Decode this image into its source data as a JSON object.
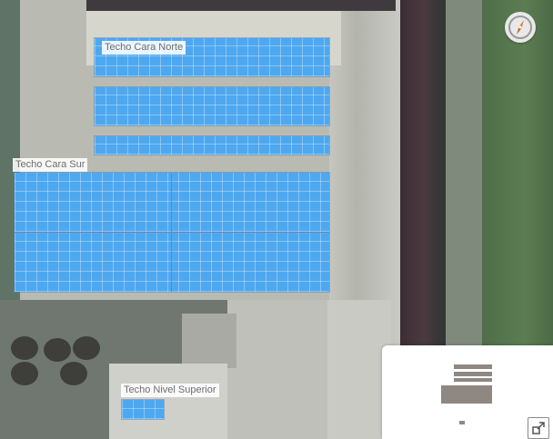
{
  "map": {
    "labels": {
      "north": "Techo Cara Norte",
      "south": "Techo Cara Sur",
      "upper": "Techo Nivel Superior"
    },
    "panel_color": "#4ea8f0"
  },
  "controls": {
    "compass_icon": "compass-icon",
    "expand_icon": "expand-icon"
  }
}
